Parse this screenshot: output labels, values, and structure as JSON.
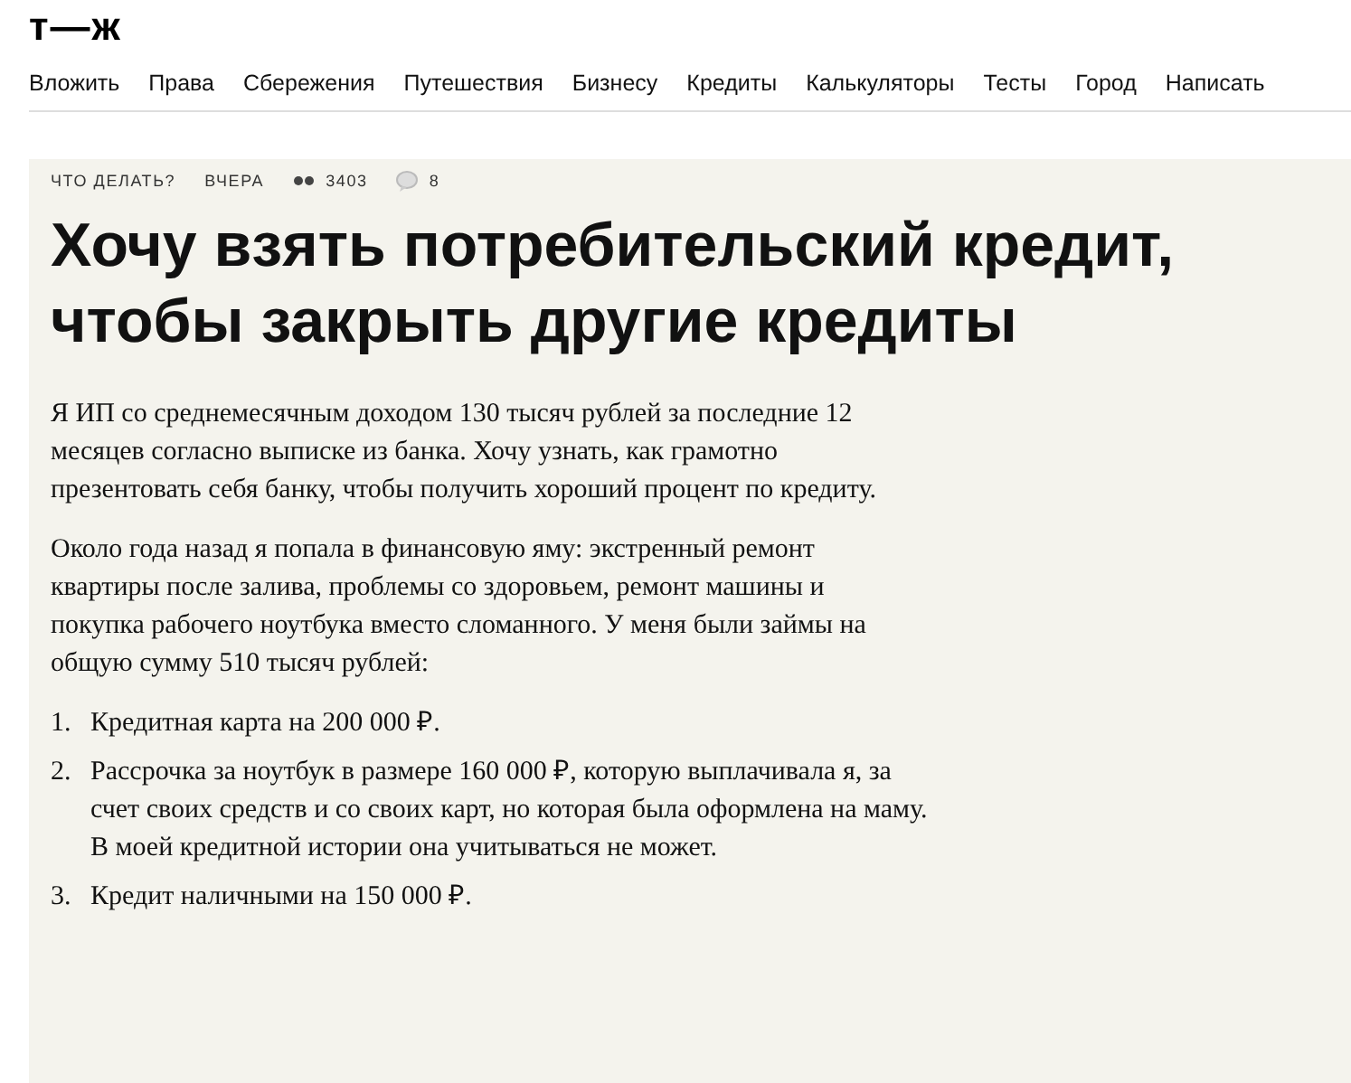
{
  "logo": "т—ж",
  "nav": [
    "Вложить",
    "Права",
    "Сбережения",
    "Путешествия",
    "Бизнесу",
    "Кредиты",
    "Калькуляторы",
    "Тесты",
    "Город",
    "Написать"
  ],
  "article": {
    "meta": {
      "rubric": "ЧТО ДЕЛАТЬ?",
      "date": "ВЧЕРА",
      "views": "3403",
      "comments": "8"
    },
    "title": "Хочу взять потребительский кредит, чтобы закрыть другие кредиты",
    "paragraphs": [
      "Я ИП со среднемесячным доходом 130 тысяч рублей за последние 12 месяцев согласно выписке из банка. Хочу узнать, как грамотно презентовать себя банку, чтобы получить хороший процент по кредиту.",
      "Около года назад я попала в финансовую яму: экстренный ремонт квартиры после залива, проблемы со здоровьем, ремонт машины и покупка рабочего ноутбука вместо сломанного. У меня были займы на общую сумму 510 тысяч рублей:"
    ],
    "list": [
      {
        "number": "1.",
        "text": "Кредитная карта на 200 000 ₽."
      },
      {
        "number": "2.",
        "text": "Рассрочка за ноутбук в размере 160 000 ₽, которую выплачивала я, за счет своих средств и со своих карт, но которая была оформлена на маму. В моей кредитной истории она учитываться не может."
      },
      {
        "number": "3.",
        "text": "Кредит наличными на 150 000 ₽."
      }
    ]
  }
}
